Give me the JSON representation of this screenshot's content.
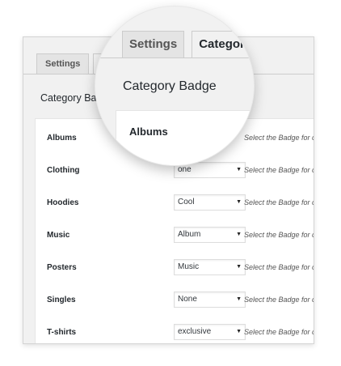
{
  "tabs": [
    {
      "label": "Settings",
      "active": false
    },
    {
      "label": "Ca",
      "active": true
    }
  ],
  "section_title": "Category Bad",
  "rows": [
    {
      "label": "Albums",
      "select_value": "",
      "hint": "Select the Badge for c"
    },
    {
      "label": "Clothing",
      "select_value": "one",
      "hint": "Select the Badge for c"
    },
    {
      "label": "Hoodies",
      "select_value": "Cool",
      "hint": "Select the Badge for c"
    },
    {
      "label": "Music",
      "select_value": "Album",
      "hint": "Select the Badge for c"
    },
    {
      "label": "Posters",
      "select_value": "Music",
      "hint": "Select the Badge for c"
    },
    {
      "label": "Singles",
      "select_value": "None",
      "hint": "Select the Badge for c"
    },
    {
      "label": "T-shirts",
      "select_value": "exclusive",
      "hint": "Select the Badge for c"
    }
  ],
  "magnifier": {
    "tabs": [
      {
        "label": "Settings",
        "active": false
      },
      {
        "label": "Category",
        "active": true
      }
    ],
    "title": "Category Badge",
    "first_label": "Albums"
  },
  "icons": {
    "dropdown": "caret-down-icon"
  },
  "colors": {
    "background": "#f1f1f1",
    "panel": "#ffffff",
    "border": "#cccccc",
    "text": "#23282d"
  }
}
